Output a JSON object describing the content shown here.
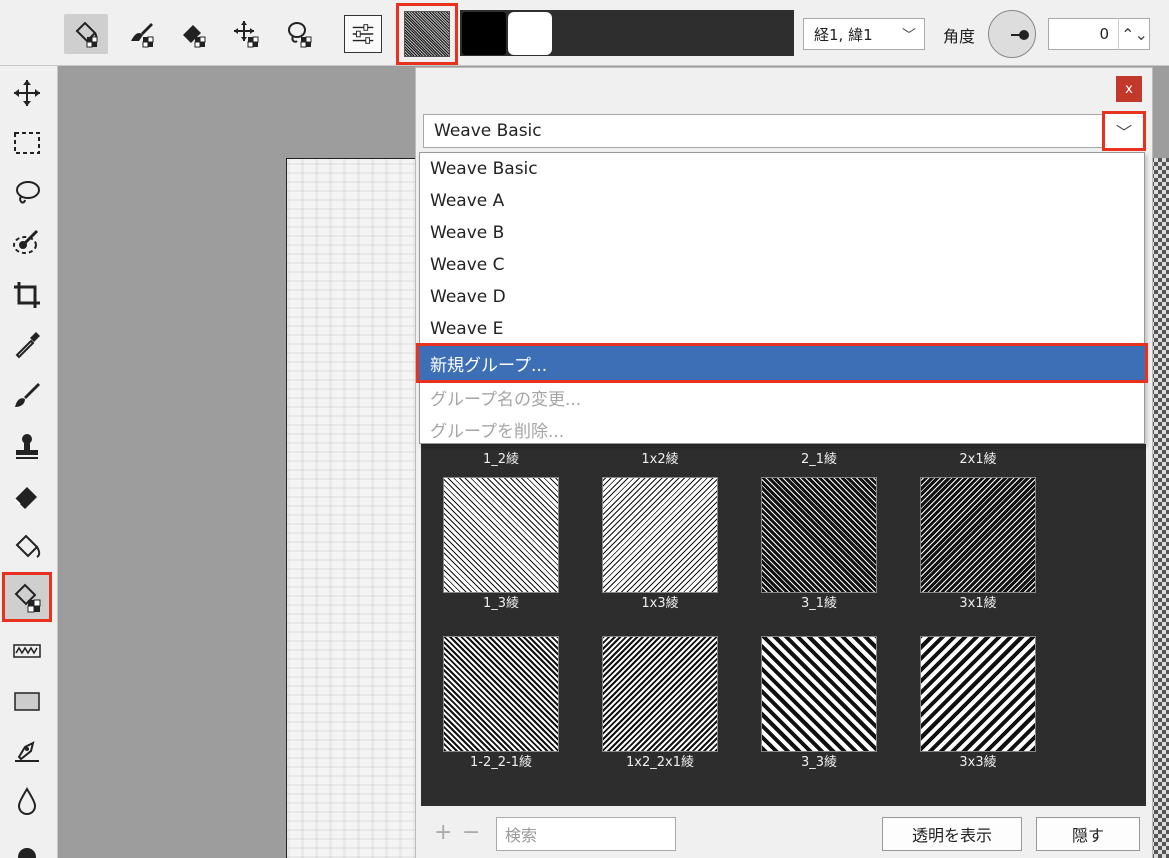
{
  "toolbar": {
    "icons": [
      "pattern-fill-icon",
      "pattern-brush-icon",
      "pattern-eraser-icon",
      "pattern-move-icon",
      "pattern-lasso-icon"
    ],
    "weave_value": "経1, 緯1",
    "angle_label": "角度",
    "angle_value": "0",
    "color_primary": "#000000",
    "color_secondary": "#ffffff"
  },
  "left_tools": [
    "move-icon",
    "rect-select-icon",
    "lasso-icon",
    "magic-select-icon",
    "crop-icon",
    "eyedropper-icon",
    "brush-icon",
    "stamp-icon",
    "eraser-icon",
    "fill-icon",
    "pattern-fill-icon",
    "wave-brush-icon",
    "rectangle-icon",
    "pen-icon",
    "drop-icon",
    "circle-icon"
  ],
  "panel": {
    "close_label": "x",
    "selected_group": "Weave Basic",
    "dropdown": {
      "items": [
        "Weave Basic",
        "Weave A",
        "Weave B",
        "Weave C",
        "Weave D",
        "Weave E"
      ],
      "new_group": "新規グループ...",
      "rename_group": "グループ名の変更...",
      "delete_group": "グループを削除..."
    },
    "grid_top_labels": [
      "1_2綾",
      "1x2綾",
      "2_1綾",
      "2x1綾"
    ],
    "patterns_row1": [
      {
        "label": "1_3綾"
      },
      {
        "label": "1x3綾"
      },
      {
        "label": "3_1綾"
      },
      {
        "label": "3x1綾"
      }
    ],
    "patterns_row2": [
      {
        "label": "1-2_2-1綾"
      },
      {
        "label": "1x2_2x1綾"
      },
      {
        "label": "3_3綾"
      },
      {
        "label": "3x3綾"
      }
    ],
    "bottom": {
      "plus": "+",
      "minus": "−",
      "search_placeholder": "検索",
      "show_transparent": "透明を表示",
      "hide": "隠す"
    }
  }
}
